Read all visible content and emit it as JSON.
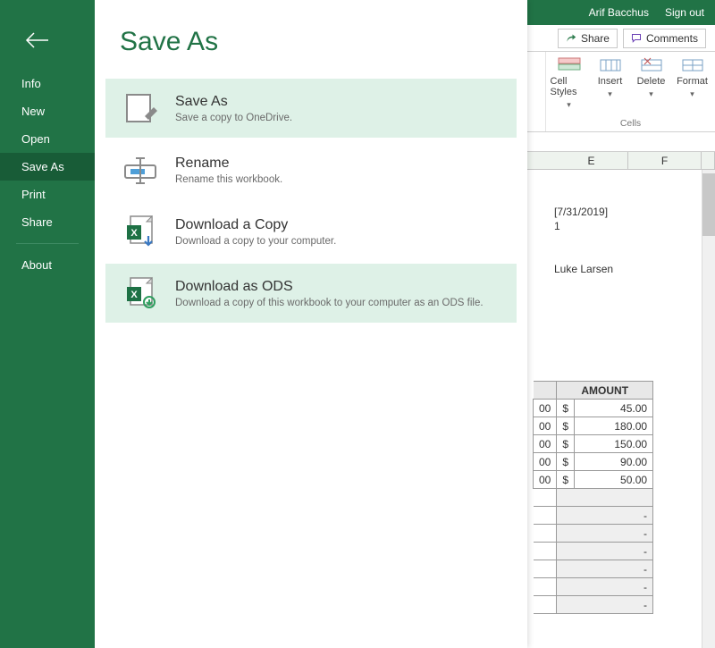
{
  "titlebar": {
    "user": "Arif Bacchus",
    "signout": "Sign out"
  },
  "ribbon": {
    "share": "Share",
    "comments": "Comments",
    "cellsGroup": "Cells",
    "buttons": {
      "styles": "Cell Styles",
      "insert": "Insert",
      "delete": "Delete",
      "format": "Format"
    }
  },
  "columns": {
    "e": "E",
    "f": "F"
  },
  "sheet": {
    "date": "[7/31/2019]",
    "one": "1",
    "name": "Luke Larsen",
    "truncatedSuffix": "00",
    "amountHeader": "AMOUNT",
    "rows": [
      {
        "cur": "$",
        "val": "45.00"
      },
      {
        "cur": "$",
        "val": "180.00"
      },
      {
        "cur": "$",
        "val": "150.00"
      },
      {
        "cur": "$",
        "val": "90.00"
      },
      {
        "cur": "$",
        "val": "50.00"
      }
    ],
    "dash": "-"
  },
  "filePane": {
    "heading": "Save As",
    "nav": {
      "info": "Info",
      "new": "New",
      "open": "Open",
      "saveAs": "Save As",
      "print": "Print",
      "share": "Share",
      "about": "About"
    },
    "options": [
      {
        "title": "Save As",
        "desc": "Save a copy to OneDrive."
      },
      {
        "title": "Rename",
        "desc": "Rename this workbook."
      },
      {
        "title": "Download a Copy",
        "desc": "Download a copy to your computer."
      },
      {
        "title": "Download as ODS",
        "desc": "Download a copy of this workbook to your computer as an ODS file."
      }
    ]
  }
}
